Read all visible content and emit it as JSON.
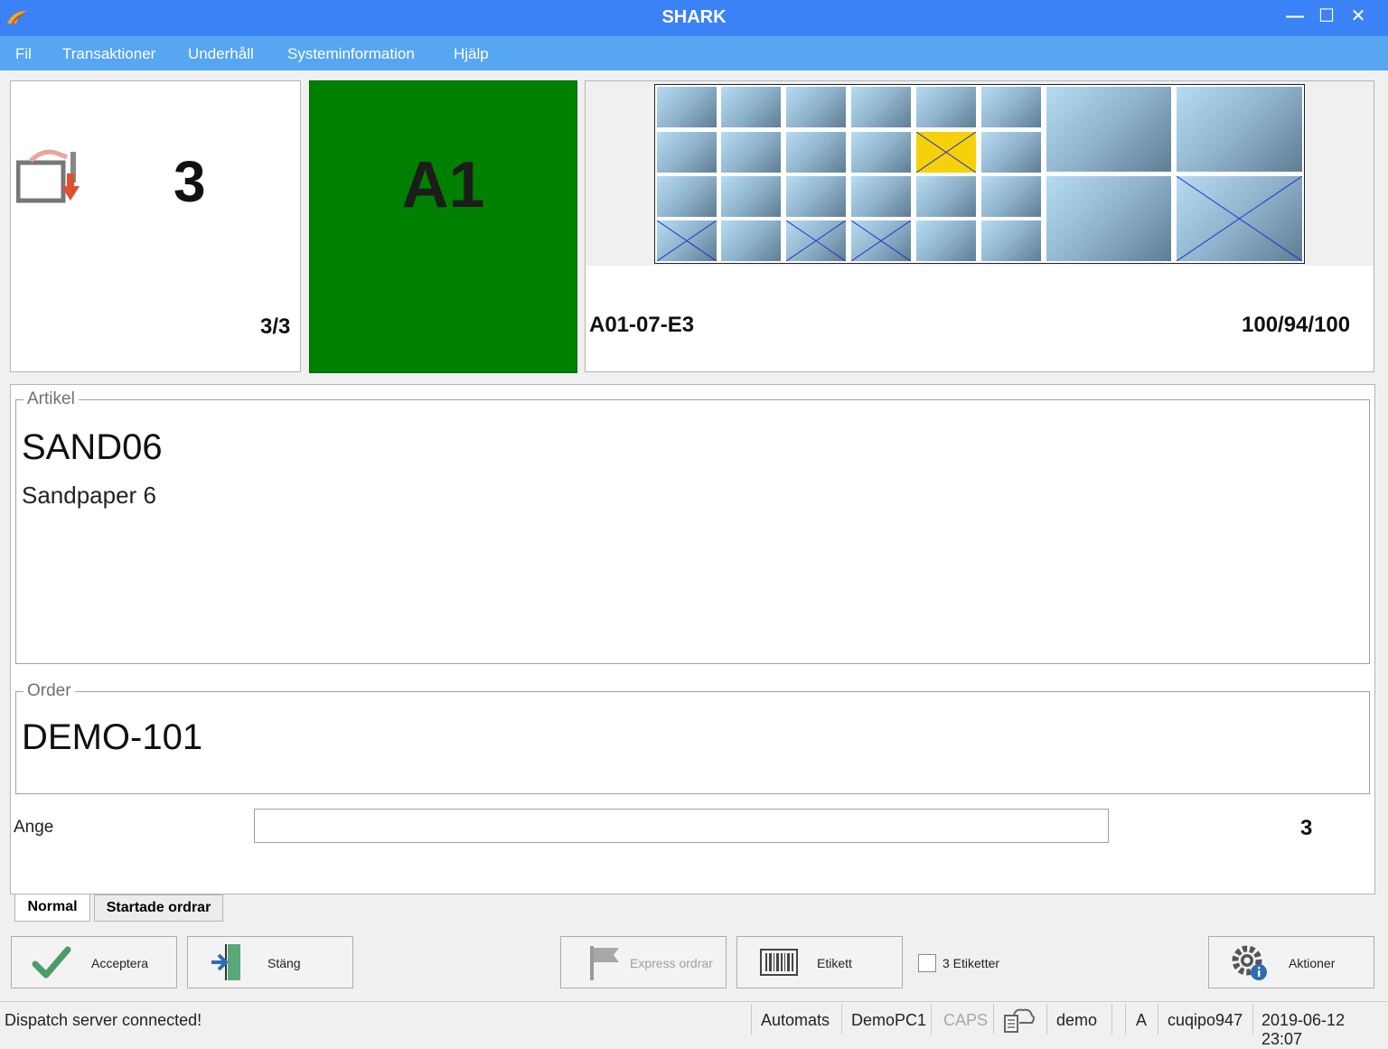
{
  "window": {
    "title": "SHARK",
    "minimize": "—",
    "maximize": "☐",
    "close": "✕"
  },
  "menu": {
    "items": [
      {
        "label": "Fil"
      },
      {
        "label": "Transaktioner"
      },
      {
        "label": "Underhåll"
      },
      {
        "label": "Systeminformation"
      },
      {
        "label": "Hjälp"
      }
    ]
  },
  "pick_panel": {
    "quantity": "3",
    "progress": "3/3",
    "icon": "pick-to-box-icon"
  },
  "zone_panel": {
    "zone": "A1",
    "color": "#008000"
  },
  "location_panel": {
    "location": "A01-07-E3",
    "stock": "100/94/100",
    "highlight_color": "#f5d10a"
  },
  "artikel": {
    "legend": "Artikel",
    "code": "SAND06",
    "description": "Sandpaper 6"
  },
  "order": {
    "legend": "Order",
    "number": "DEMO-101"
  },
  "input": {
    "label": "Ange",
    "value": "",
    "count": "3"
  },
  "tabs": [
    {
      "label": "Normal",
      "active": true
    },
    {
      "label": "Startade ordrar",
      "active": false
    }
  ],
  "buttons": {
    "accept": "Acceptera",
    "close": "Stäng",
    "express": "Express ordrar",
    "label": "Etikett",
    "labels_checkbox": "3 Etiketter",
    "actions": "Aktioner"
  },
  "status": {
    "message": "Dispatch server connected!",
    "mode": "Automats",
    "pc": "DemoPC1",
    "caps": "CAPS",
    "user": "demo",
    "flag": "A",
    "id": "cuqipo947",
    "datetime": "2019-06-12 23:07"
  }
}
